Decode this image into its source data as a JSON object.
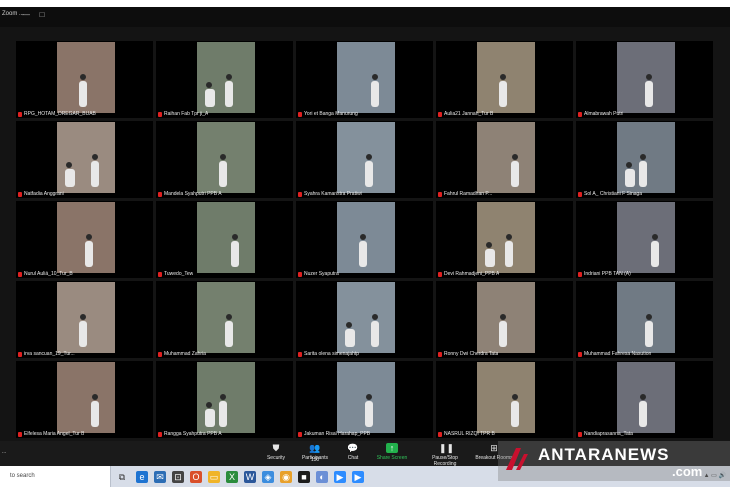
{
  "window": {
    "title": "Zoom ..."
  },
  "participants": [
    {
      "name": "RPG_HOTAM_DREGAR_BUAB"
    },
    {
      "name": "Raihan Fab Tpr ji_A"
    },
    {
      "name": "Yori et Banga Manurung"
    },
    {
      "name": "Aulia21 Jannah_Tur B"
    },
    {
      "name": "Almabrawah Putri"
    },
    {
      "name": "Natfadia Anggrani"
    },
    {
      "name": "Mandela Syahputri PPB A"
    },
    {
      "name": "Syahra Kamaristra Pratiwi"
    },
    {
      "name": "Fahrul Ramadhan P..."
    },
    {
      "name": "Sol A_ Christiani F Sinaga"
    },
    {
      "name": "Nurul Auliá_10_Tur_B"
    },
    {
      "name": "Tuwedo_Tew"
    },
    {
      "name": "Nuzer Syaputra"
    },
    {
      "name": "Devi Rahmadjeni_PPB A"
    },
    {
      "name": "Indriani PPB TAN (A)"
    },
    {
      "name": "irva sancuan_19_Tur..."
    },
    {
      "name": "Muhammad Zahria"
    },
    {
      "name": "Sarita olena simenajahtp"
    },
    {
      "name": "Ronny Dwi Cherdra Tata"
    },
    {
      "name": "Muhammad Fahresa Nasution"
    },
    {
      "name": "Elfelesa Maria Angel_Tur B"
    },
    {
      "name": "Rangga Syahputra PPB A"
    },
    {
      "name": "Jakuman Risal Harahap_PPB"
    },
    {
      "name": "NASRUL RIZQI TPR B"
    },
    {
      "name": "Nandiaprasanna_Tata"
    }
  ],
  "toolbar": {
    "leave": "...",
    "items": [
      {
        "label": "Security",
        "icon": "shield-icon"
      },
      {
        "label": "Participants",
        "icon": "participants-icon",
        "count": "150"
      },
      {
        "label": "Chat",
        "icon": "chat-icon"
      },
      {
        "label": "Share Screen",
        "icon": "share-screen-icon"
      },
      {
        "label": "Pause/Stop Recording",
        "icon": "record-icon"
      },
      {
        "label": "Breakout Rooms",
        "icon": "breakout-icon"
      }
    ]
  },
  "taskbar": {
    "search_placeholder": "to search"
  },
  "watermark": {
    "brand": "ANTARANEWS",
    "suffix": ".com"
  },
  "colors": {
    "share_green": "#22b14c",
    "mic_red": "#e02020",
    "brand_red": "#c8102e"
  }
}
